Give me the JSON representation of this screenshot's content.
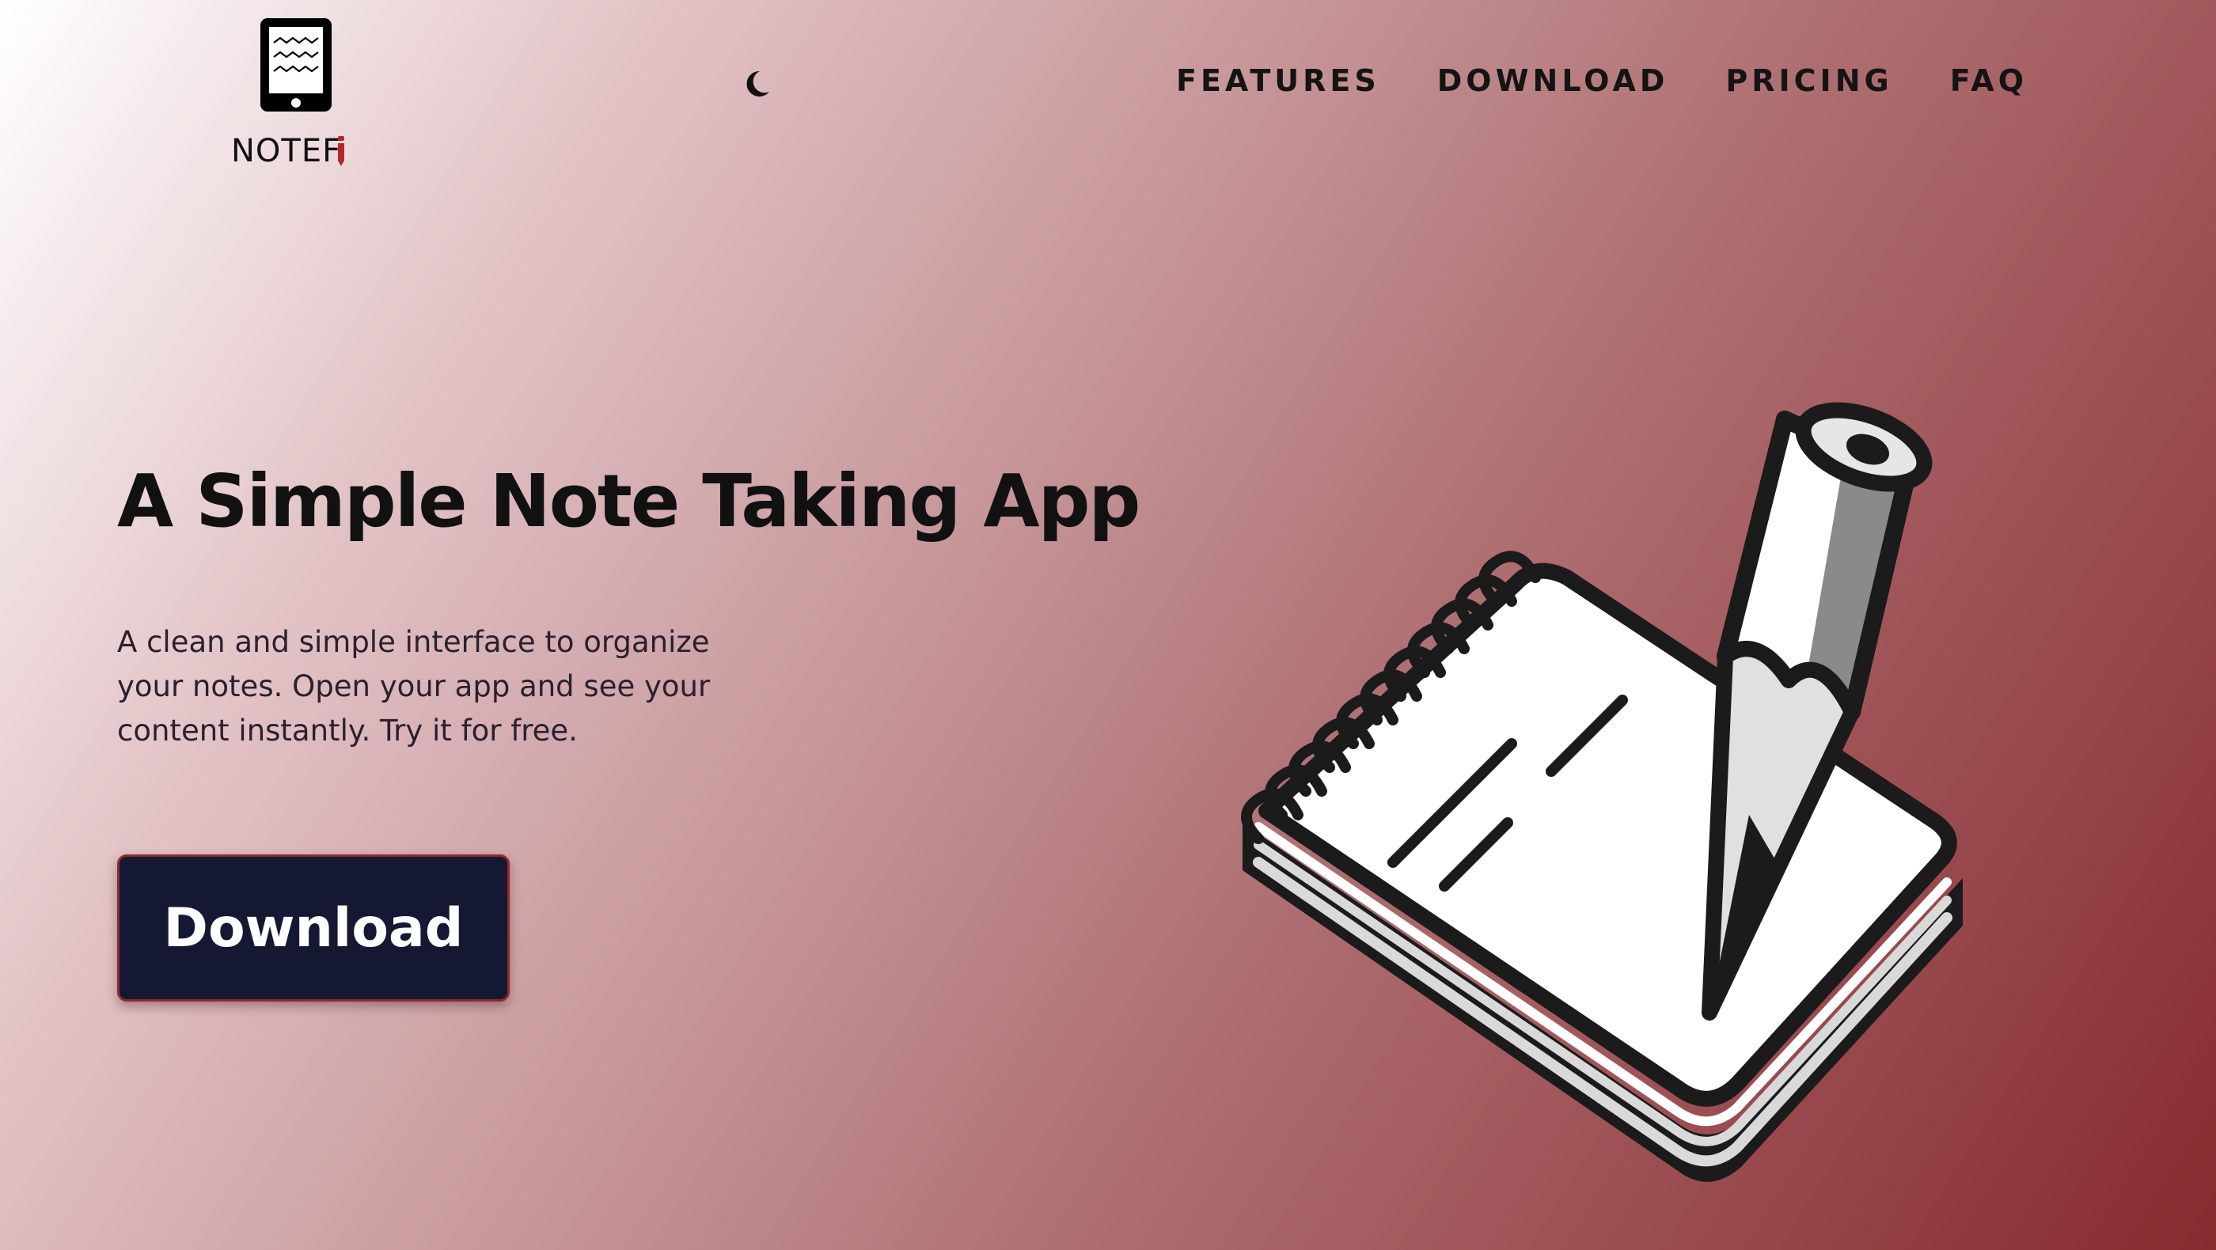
{
  "brand": {
    "name": "NOTEF",
    "icon": "tablet-notes-icon",
    "accent_icon": "pencil-icon",
    "accent_color": "#b3262c"
  },
  "header": {
    "theme_toggle_icon": "moon-icon",
    "nav": [
      {
        "label": "FEATURES"
      },
      {
        "label": "DOWNLOAD"
      },
      {
        "label": "PRICING"
      },
      {
        "label": "FAQ"
      }
    ]
  },
  "hero": {
    "title": "A Simple Note Taking App",
    "description": "A clean and simple interface to organize your notes. Open your app and see your content instantly. Try it for free.",
    "cta_label": "Download",
    "illustration": "notepad-with-pencil-illustration"
  },
  "colors": {
    "gradient_start": "#ffffff",
    "gradient_end": "#862b2e",
    "button_bg": "#141833",
    "button_border": "#8f2a2f"
  }
}
